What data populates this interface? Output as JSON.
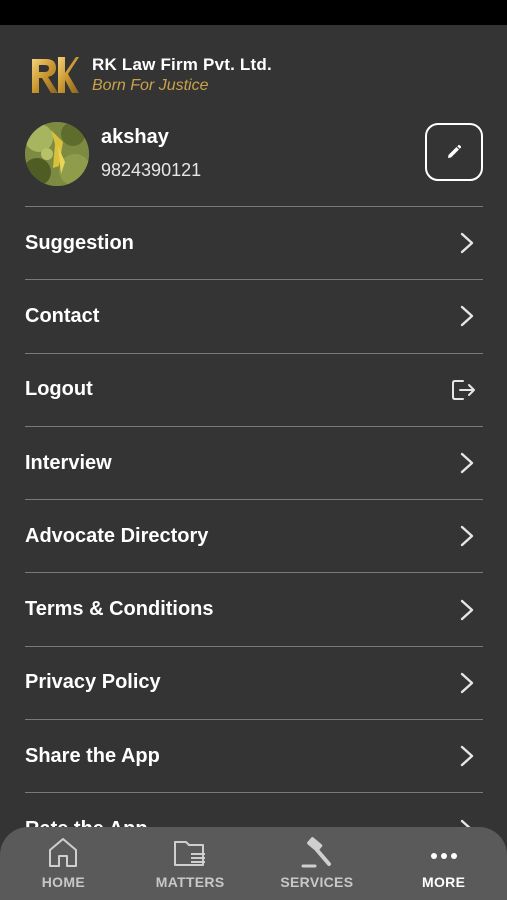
{
  "header": {
    "firm_name": "RK Law Firm Pvt. Ltd.",
    "tagline": "Born For Justice",
    "logo_icon": "rk-monogram-logo",
    "accent_color": "#c9a24a"
  },
  "profile": {
    "name": "akshay",
    "phone": "9824390121",
    "edit_icon": "pencil-icon"
  },
  "menu": {
    "items": [
      {
        "label": "Suggestion",
        "icon": "chevron-right-icon"
      },
      {
        "label": "Contact",
        "icon": "chevron-right-icon"
      },
      {
        "label": "Logout",
        "icon": "logout-icon"
      },
      {
        "label": "Interview",
        "icon": "chevron-right-icon"
      },
      {
        "label": "Advocate Directory",
        "icon": "chevron-right-icon"
      },
      {
        "label": "Terms & Conditions",
        "icon": "chevron-right-icon"
      },
      {
        "label": "Privacy Policy",
        "icon": "chevron-right-icon"
      },
      {
        "label": "Share the App",
        "icon": "chevron-right-icon"
      },
      {
        "label": "Rate the App",
        "icon": "chevron-right-icon"
      }
    ]
  },
  "bottom_nav": {
    "items": [
      {
        "label": "HOME",
        "icon": "home-icon",
        "active": false
      },
      {
        "label": "MATTERS",
        "icon": "folder-icon",
        "active": false
      },
      {
        "label": "SERVICES",
        "icon": "gavel-icon",
        "active": false
      },
      {
        "label": "MORE",
        "icon": "more-dots-icon",
        "active": true
      }
    ]
  }
}
